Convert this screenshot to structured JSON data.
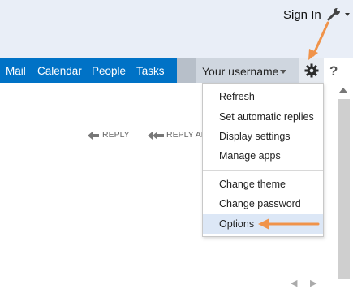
{
  "header": {
    "sign_in_label": "Sign In",
    "wrench_icon": "wrench-icon"
  },
  "nav": {
    "items": [
      {
        "label": "Mail"
      },
      {
        "label": "Calendar"
      },
      {
        "label": "People"
      },
      {
        "label": "Tasks"
      }
    ],
    "username_placeholder": "Your username",
    "settings_icon": "gear-icon",
    "help_label": "?"
  },
  "reading_pane": {
    "reply_label": "REPLY",
    "reply_all_label": "REPLY AL"
  },
  "settings_menu": {
    "items": [
      {
        "label": "Refresh"
      },
      {
        "label": "Set automatic replies"
      },
      {
        "label": "Display settings"
      },
      {
        "label": "Manage apps"
      },
      {
        "label": "Change theme"
      },
      {
        "label": "Change password"
      },
      {
        "label": "Options"
      }
    ],
    "highlighted": "Options"
  },
  "colors": {
    "nav_blue": "#0072c6",
    "annotation_orange": "#f0934a",
    "highlight": "#dce7f6"
  }
}
